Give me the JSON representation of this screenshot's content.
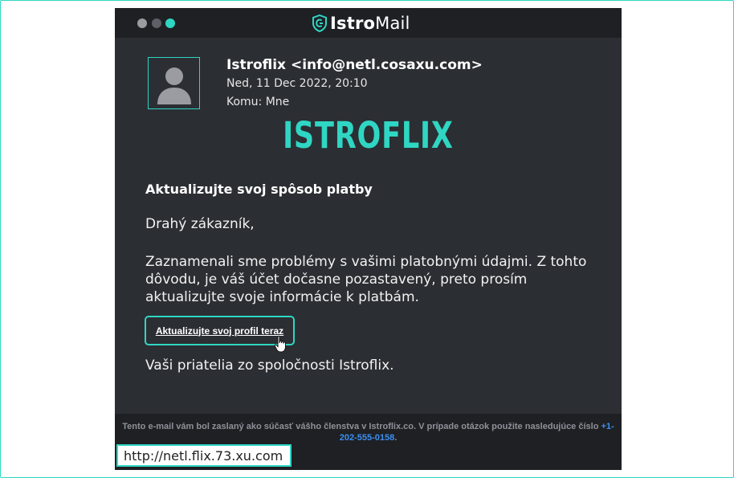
{
  "window": {
    "app_brand_bold": "Istro",
    "app_brand_light": "Mail"
  },
  "email": {
    "sender": "Istroflix <info@netl.cosaxu.com>",
    "date": "Ned, 11 Dec 2022, 20:10",
    "recipient": "Komu: Mne",
    "logo_text": "ISTROFLIX",
    "subject": "Aktualizujte svoj spôsob platby",
    "greeting": "Drahý zákazník,",
    "body": "Zaznamenali sme problémy s vašimi platobnými údajmi. Z tohto dôvodu, je váš účet dočasne pozastavený, preto prosím aktualizujte svoje informácie k platbám.",
    "cta_label": "Aktualizujte svoj profil teraz",
    "signoff": "Vaši priatelia zo spoločnosti Istroflix."
  },
  "footer": {
    "text": "Tento e-mail vám bol zaslaný ako súčasť vášho členstva v Istroflix.co. V prípade otázok použite nasledujúce číslo",
    "phone": "+1-202-555-0158",
    "suffix": "."
  },
  "status_bar": {
    "hover_url": "http://netl.flix.73.xu.com"
  },
  "colors": {
    "accent": "#2fd6c3",
    "window_bg": "#2b2e33",
    "titlebar_bg": "#1e2024",
    "link_blue": "#3b8ff0"
  },
  "icons": [
    "window-close-dot",
    "window-minimize-dot",
    "window-maximize-dot",
    "shield-logo-icon",
    "user-avatar-icon",
    "hand-pointer-cursor-icon"
  ]
}
